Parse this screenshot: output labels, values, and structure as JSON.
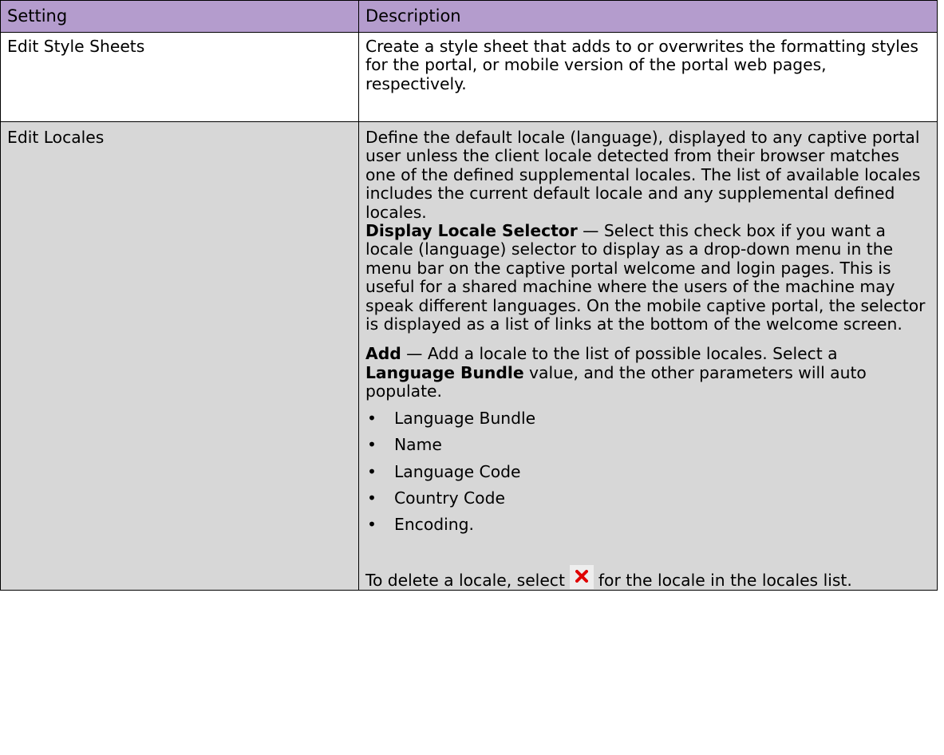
{
  "table": {
    "header": {
      "setting": "Setting",
      "description": "Description"
    },
    "rows": [
      {
        "setting": "Edit Style Sheets",
        "description": "Create a style sheet that adds to or overwrites the formatting styles for the portal, or mobile version of the portal web pages, respectively."
      },
      {
        "setting": "Edit Locales",
        "description": "Define the default locale (language), displayed to any captive portal user unless the client locale detected from their browser matches one of the defined supplemental locales. The list of available locales includes the current default locale and any supplemental defined locales.",
        "display_locale_selector": {
          "term": "Display Locale Selector",
          "text": " — Select this check box if you want a locale (language) selector to display as a drop-down menu in the menu bar on the captive portal welcome and login pages. This is useful for a shared machine where the users of the machine may speak different languages. On the mobile captive portal, the selector is displayed as a list of links at the bottom of the welcome screen."
        },
        "add": {
          "term": "Add",
          "text_1": " — Add a locale to the list of possible locales. Select a ",
          "bundle_term": "Language Bundle",
          "text_2": " value, and the other parameters will auto populate."
        },
        "bullets": [
          "Language Bundle",
          "Name",
          "Language Code",
          "Country Code",
          "Encoding."
        ],
        "bullet_char": "•",
        "delete": {
          "text_before": "To delete a locale, select",
          "icon": "delete-x-icon",
          "icon_color": "#e00000",
          "text_after": "for the locale in the locales list."
        }
      }
    ]
  },
  "colors": {
    "header_bg": "#b49ccd",
    "shaded_row_bg": "#d7d7d7"
  }
}
